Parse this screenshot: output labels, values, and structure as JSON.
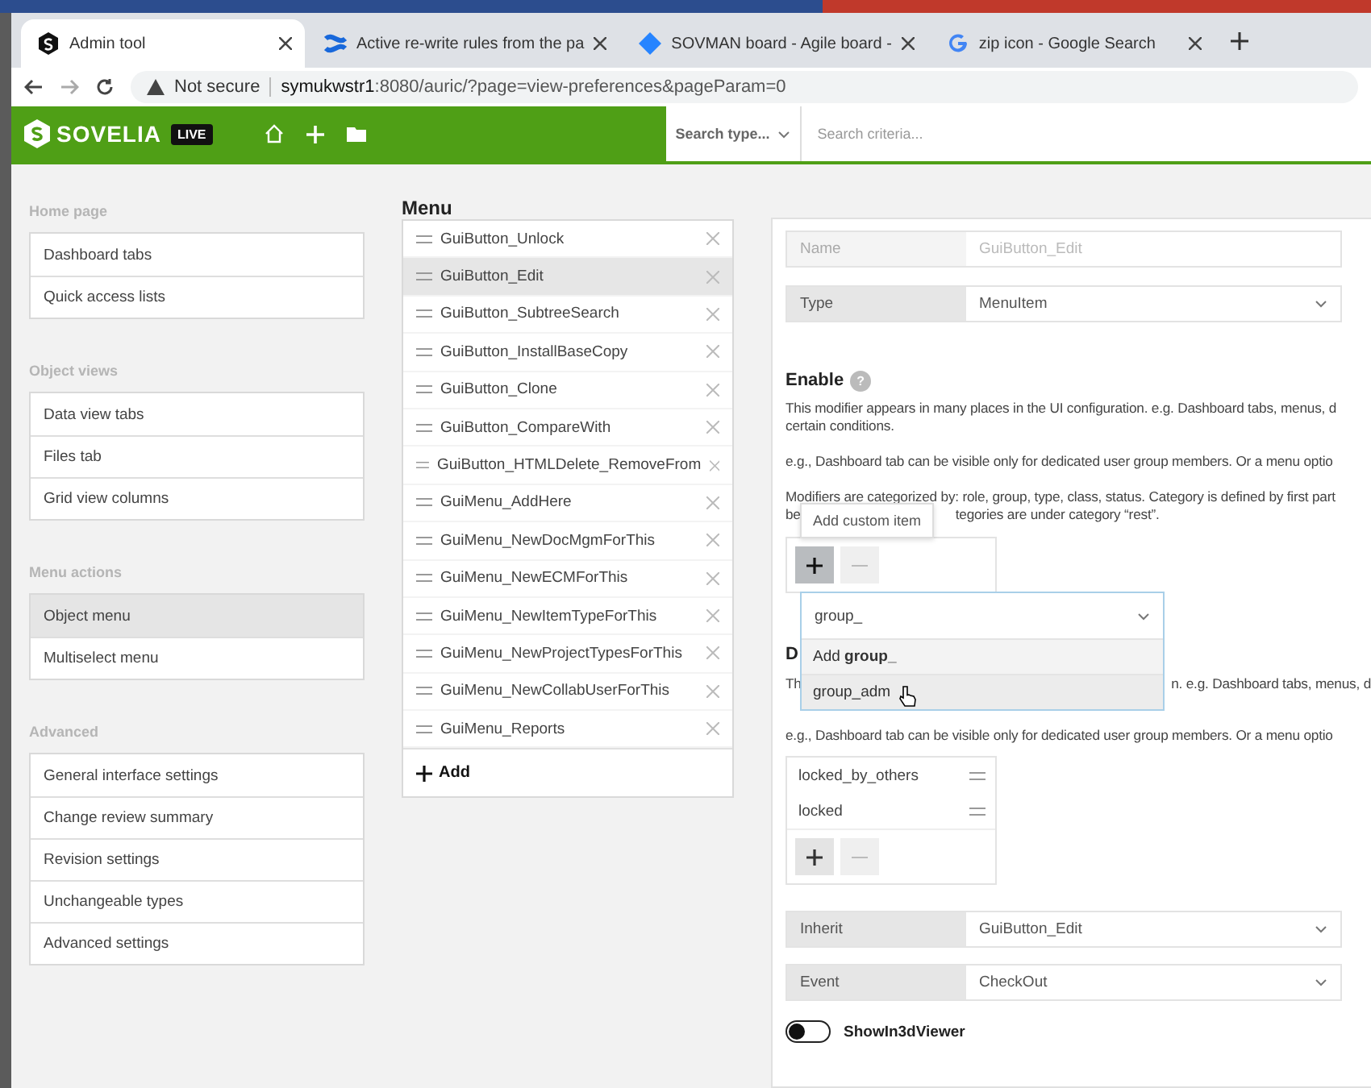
{
  "browser": {
    "tabs": [
      {
        "title": "Admin tool",
        "selected": true,
        "kind": "sovelia"
      },
      {
        "title": "Active re-write rules from the pa",
        "selected": false,
        "kind": "confluence"
      },
      {
        "title": "SOVMAN board - Agile board -",
        "selected": false,
        "kind": "jira"
      },
      {
        "title": "zip icon - Google Search",
        "selected": false,
        "kind": "google"
      }
    ],
    "address": {
      "security": "Not secure",
      "host": "symukwstr1",
      "path": ":8080/auric/?page=view-preferences&pageParam=0"
    }
  },
  "header": {
    "logo": "SOVELIA",
    "badge": "LIVE",
    "search_type": "Search type...",
    "search_placeholder": "Search criteria..."
  },
  "sidebar": [
    {
      "title": "Home page",
      "items": [
        {
          "label": "Dashboard tabs",
          "selected": false
        },
        {
          "label": "Quick access lists",
          "selected": false
        }
      ]
    },
    {
      "title": "Object views",
      "items": [
        {
          "label": "Data view tabs",
          "selected": false
        },
        {
          "label": "Files tab",
          "selected": false
        },
        {
          "label": "Grid view columns",
          "selected": false
        }
      ]
    },
    {
      "title": "Menu actions",
      "items": [
        {
          "label": "Object menu",
          "selected": true
        },
        {
          "label": "Multiselect menu",
          "selected": false
        }
      ]
    },
    {
      "title": "Advanced",
      "items": [
        {
          "label": "General interface settings",
          "selected": false
        },
        {
          "label": "Change review summary",
          "selected": false
        },
        {
          "label": "Revision settings",
          "selected": false
        },
        {
          "label": "Unchangeable types",
          "selected": false
        },
        {
          "label": "Advanced settings",
          "selected": false
        }
      ]
    }
  ],
  "menu": {
    "title": "Menu",
    "items": [
      {
        "label": "GuiButton_Unlock",
        "selected": false
      },
      {
        "label": "GuiButton_Edit",
        "selected": true
      },
      {
        "label": "GuiButton_SubtreeSearch",
        "selected": false
      },
      {
        "label": "GuiButton_InstallBaseCopy",
        "selected": false
      },
      {
        "label": "GuiButton_Clone",
        "selected": false
      },
      {
        "label": "GuiButton_CompareWith",
        "selected": false
      },
      {
        "label": "GuiButton_HTMLDelete_RemoveFrom",
        "selected": false
      },
      {
        "label": "GuiMenu_AddHere",
        "selected": false
      },
      {
        "label": "GuiMenu_NewDocMgmForThis",
        "selected": false
      },
      {
        "label": "GuiMenu_NewECMForThis",
        "selected": false
      },
      {
        "label": "GuiMenu_NewItemTypeForThis",
        "selected": false
      },
      {
        "label": "GuiMenu_NewProjectTypesForThis",
        "selected": false
      },
      {
        "label": "GuiMenu_NewCollabUserForThis",
        "selected": false
      },
      {
        "label": "GuiMenu_Reports",
        "selected": false
      }
    ],
    "add": "Add"
  },
  "detail": {
    "name": {
      "label": "Name",
      "value": "GuiButton_Edit",
      "disabled": true
    },
    "type": {
      "label": "Type",
      "value": "MenuItem"
    },
    "enable": {
      "title": "Enable",
      "help": "?",
      "lines": [
        "This modifier appears in many places in the UI configuration. e.g. Dashboard tabs, menus, d",
        "certain conditions."
      ],
      "example": "e.g., Dashboard tab can be visible only for dedicated user group members. Or a menu optio",
      "categories": "Modifiers are categorized by: role, group, type, class, status. Category is defined by first part",
      "categories_left": "be",
      "categories_right": "tegories are under category “rest”."
    },
    "tooltip": "Add custom item",
    "dropdown": {
      "value": "group_",
      "options": [
        {
          "label": "Add **group_**",
          "hovered": false
        },
        {
          "label": "group_adm",
          "hovered": true
        }
      ]
    },
    "disable": {
      "title": "D",
      "line_left": "Th",
      "line_right": "n. e.g. Dashboard tabs, menus, d",
      "example": "e.g., Dashboard tab can be visible only for dedicated user group members. Or a menu optio",
      "items": [
        "locked_by_others",
        "locked"
      ]
    },
    "inherit": {
      "label": "Inherit",
      "value": "GuiButton_Edit"
    },
    "event": {
      "label": "Event",
      "value": "CheckOut"
    },
    "toggle": {
      "label": "ShowIn3dViewer",
      "on": false
    }
  }
}
